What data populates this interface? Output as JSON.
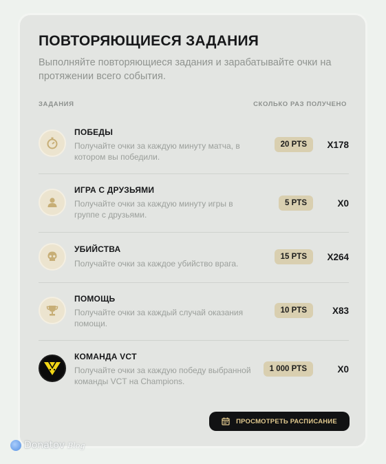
{
  "header": {
    "title": "ПОВТОРЯЮЩИЕСЯ ЗАДАНИЯ",
    "subtitle": "Выполняйте повторяющиеся задания и зарабатывайте очки на протяжении всего события."
  },
  "columns": {
    "left": "ЗАДАНИЯ",
    "right": "СКОЛЬКО РАЗ ПОЛУЧЕНО"
  },
  "quests": [
    {
      "icon": "stopwatch-icon",
      "title": "ПОБЕДЫ",
      "description": "Получайте очки за каждую минуту матча, в котором вы победили.",
      "points": "20 PTS",
      "count": "X178"
    },
    {
      "icon": "person-icon",
      "title": "ИГРА С ДРУЗЬЯМИ",
      "description": "Получайте очки за каждую минуту игры в группе с друзьями.",
      "points": "5 PTS",
      "count": "X0"
    },
    {
      "icon": "skull-icon",
      "title": "УБИЙСТВА",
      "description": "Получайте очки за каждое убийство врага.",
      "points": "15 PTS",
      "count": "X264"
    },
    {
      "icon": "trophy-icon",
      "title": "ПОМОЩЬ",
      "description": "Получайте очки за каждый случай оказания помощи.",
      "points": "10 PTS",
      "count": "X83"
    },
    {
      "icon": "team-logo-icon",
      "title": "КОМАНДА VCT",
      "description": "Получайте очки за каждую победу выбранной команды VCT на Champions.",
      "points": "1 000 PTS",
      "count": "X0"
    }
  ],
  "schedule_button": {
    "label": "ПРОСМОТРЕТЬ РАСПИСАНИЕ",
    "icon": "calendar-icon"
  },
  "watermark": {
    "brand": "Donatov",
    "script": "Blog"
  },
  "colors": {
    "card_bg": "#e3e5e2",
    "points_badge": "#d9cfb0",
    "button_bg": "#111213",
    "button_text": "#e1c98e"
  }
}
